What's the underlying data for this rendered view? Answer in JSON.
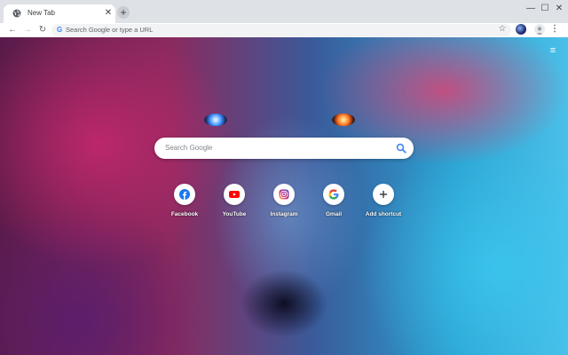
{
  "tab": {
    "title": "New Tab",
    "close_glyph": "✕",
    "favicon": "globe-icon"
  },
  "tabstrip": {
    "new_tab_glyph": "+"
  },
  "window": {
    "minimize_glyph": "—",
    "maximize_glyph": "☐",
    "close_glyph": "✕"
  },
  "toolbar": {
    "back_glyph": "←",
    "forward_glyph": "→",
    "reload_glyph": "↻",
    "omnibox_g": "G",
    "omnibox_placeholder": "Search Google or type a URL",
    "star_glyph": "☆",
    "menu_glyph": "⋮"
  },
  "page": {
    "menu_glyph": "≡",
    "search_placeholder": "Search Google",
    "shortcuts": [
      {
        "label": "Facebook",
        "icon": "facebook-icon"
      },
      {
        "label": "YouTube",
        "icon": "youtube-icon"
      },
      {
        "label": "Instagram",
        "icon": "instagram-icon"
      },
      {
        "label": "Gmail",
        "icon": "google-icon"
      },
      {
        "label": "Add shortcut",
        "icon": "plus-icon"
      }
    ]
  },
  "colors": {
    "chrome_frame": "#dee1e6",
    "omnibox_bg": "#f1f3f4",
    "facebook": "#1877f2",
    "youtube": "#ff0000",
    "instagram": "#c13584",
    "google_blue": "#4285f4"
  }
}
